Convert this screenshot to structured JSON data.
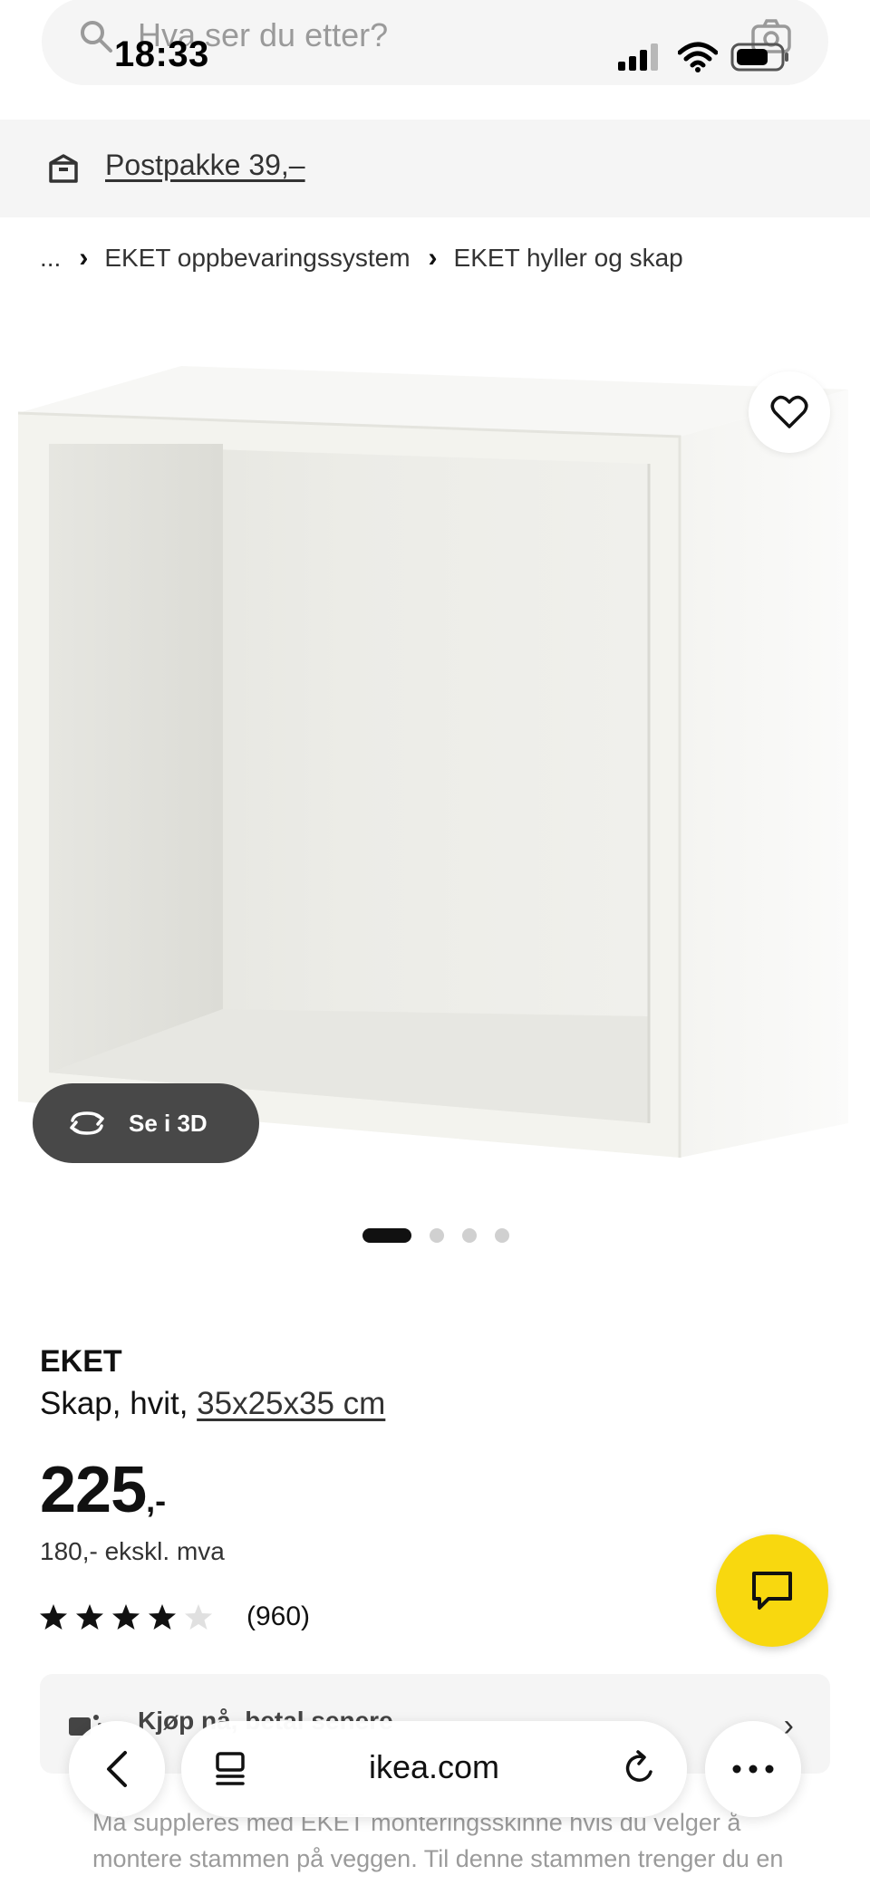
{
  "status_bar": {
    "time": "18:33"
  },
  "search": {
    "placeholder": "Hva ser du etter?"
  },
  "delivery": {
    "text": "Postpakke 39,–"
  },
  "breadcrumb": {
    "items": [
      "...",
      "EKET oppbevaringssystem",
      "EKET hyller og skap"
    ]
  },
  "gallery": {
    "see_3d_label": "Se i 3D",
    "dots": 4,
    "active_index": 0
  },
  "product": {
    "name": "EKET",
    "desc_prefix": "Skap, hvit, ",
    "size": "35x25x35 cm",
    "price_int": "225",
    "price_suffix": ",-",
    "price_ex_vat": "180,- ekskl. mva",
    "rating_value": 4,
    "rating_max": 5,
    "rating_count": "(960)"
  },
  "buy_card": {
    "label": "Kjøp nå, betal senere"
  },
  "info": {
    "text": "Må suppleres med EKET monteringsskinne hvis du velger å montere stammen på veggen. Til denne stammen trenger du en"
  },
  "browser": {
    "url": "ikea.com"
  },
  "colors": {
    "accent_yellow": "#f8d80f",
    "grey_bg": "#f5f5f5",
    "dark_button": "#484848"
  }
}
